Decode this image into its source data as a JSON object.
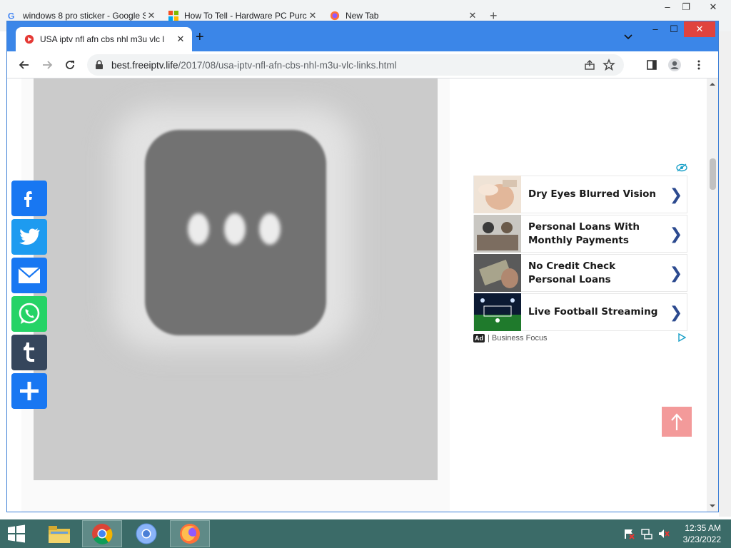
{
  "background_browser": {
    "tabs": [
      {
        "title": "windows 8 pro sticker - Google S"
      },
      {
        "title": "How To Tell - Hardware PC Purc"
      },
      {
        "title": "New Tab"
      }
    ],
    "new_tab_label": "+",
    "window_controls": {
      "minimize": "–",
      "restore": "❐",
      "close": "✕"
    }
  },
  "browser": {
    "tab": {
      "title": "USA iptv nfl afn cbs nhl m3u vlc l",
      "close_label": "✕"
    },
    "new_tab_label": "+",
    "window_controls": {
      "minimize": "–",
      "maximize": "☐",
      "close": "✕"
    },
    "url": {
      "host": "best.freeiptv.life",
      "path": "/2017/08/usa-iptv-nfl-afn-cbs-nhl-m3u-vlc-links.html"
    }
  },
  "share_buttons": [
    {
      "name": "facebook",
      "color": "#1877f2"
    },
    {
      "name": "twitter",
      "color": "#1d9bf0"
    },
    {
      "name": "email",
      "color": "#1877f2"
    },
    {
      "name": "whatsapp",
      "color": "#25d366"
    },
    {
      "name": "tumblr",
      "color": "#35465c"
    },
    {
      "name": "share",
      "color": "#1877f2"
    }
  ],
  "ad": {
    "items": [
      {
        "text": "Dry Eyes Blurred Vision"
      },
      {
        "text": "Personal Loans With Monthly Payments"
      },
      {
        "text": "No Credit Check Personal Loans"
      },
      {
        "text": "Live Football Streaming"
      }
    ],
    "badge": "Ad",
    "source": "| Business Focus"
  },
  "taskbar": {
    "time": "12:35 AM",
    "date": "3/23/2022"
  },
  "colors": {
    "chrome_frame": "#3b86e8",
    "close_red": "#e0433e",
    "taskbar": "#3b6b68",
    "to_top": "#f39a9a"
  }
}
